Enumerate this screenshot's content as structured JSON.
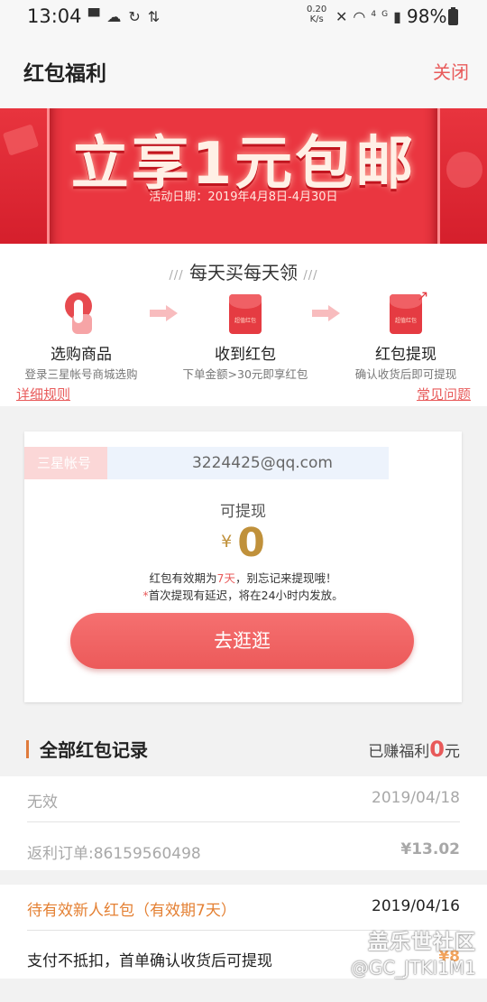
{
  "status_bar": {
    "time": "13:04",
    "net_speed_value": "0.20",
    "net_speed_unit": "K/s",
    "network_type": "4G",
    "battery": "98%"
  },
  "header": {
    "title": "红包福利",
    "close_label": "关闭"
  },
  "banner": {
    "headline": "立享1元包邮",
    "date": "活动日期：2019年4月8日-4月30日"
  },
  "steps": {
    "slogan_dash": "///",
    "slogan": "每天买每天领",
    "items": [
      {
        "label": "选购商品",
        "sub": "登录三星帐号商城选购",
        "icon": "tap-hand-icon"
      },
      {
        "label": "收到红包",
        "sub": "下单金额>30元即享红包",
        "icon": "red-packet-icon",
        "packet_text": "超值红包"
      },
      {
        "label": "红包提现",
        "sub": "确认收货后即可提现",
        "icon": "red-packet-withdraw-icon",
        "packet_text": "超值红包"
      }
    ],
    "rules_link": "详细规则",
    "faq_link": "常见问题"
  },
  "account": {
    "tag": "三星帐号",
    "value": "3224425@qq.com",
    "withdrawable_label": "可提现",
    "currency": "¥",
    "amount": "0",
    "note1_prefix": "红包有效期为",
    "note1_days": "7天",
    "note1_suffix": "，别忘记来提现哦！",
    "note2_star": "*",
    "note2": "首次提现有延迟，将在24小时内发放。",
    "button": "去逛逛"
  },
  "records": {
    "title": "全部红包记录",
    "earned_prefix": "已赚福利",
    "earned_value": "0",
    "earned_suffix": "元",
    "items": [
      {
        "status": "无效",
        "date": "2019/04/18",
        "order": "返利订单:86159560498",
        "amount": "¥13.02"
      },
      {
        "status": "待有效新人红包（有效期7天）",
        "date": "2019/04/16",
        "desc": "支付不抵扣，首单确认收货后可提现",
        "amount": "¥8"
      }
    ]
  },
  "watermark": {
    "line1": "盖乐世社区",
    "line2": "@GC_JTKI1M1"
  }
}
